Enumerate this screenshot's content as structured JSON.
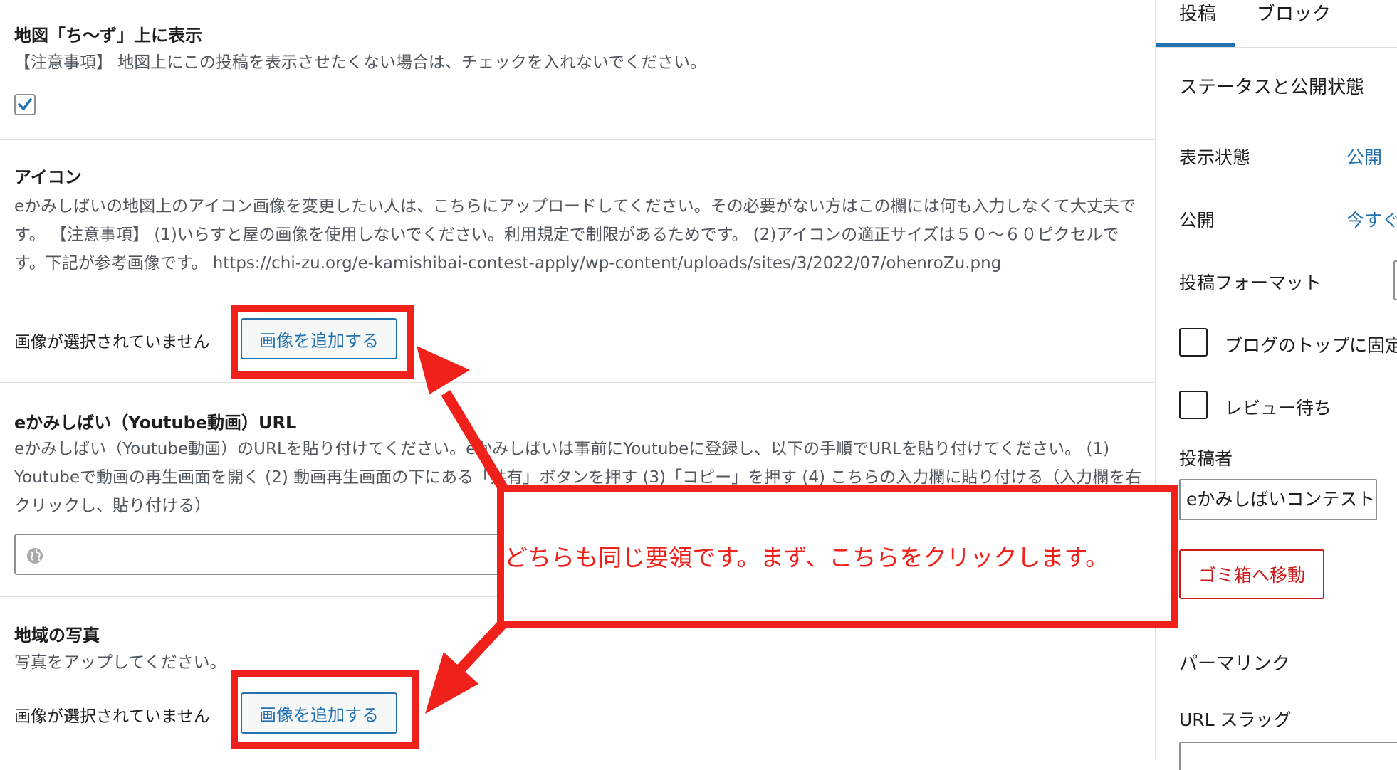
{
  "main": {
    "map_section": {
      "title": "地図「ち〜ず」上に表示",
      "description": "【注意事項】 地図上にこの投稿を表示させたくない場合は、チェックを入れないでください。",
      "checked": true
    },
    "icon_section": {
      "title": "アイコン",
      "description": "eかみしばいの地図上のアイコン画像を変更したい人は、こちらにアップロードしてください。その必要がない方はこの欄には何も入力しなくて大丈夫です。 【注意事項】 (1)いらすと屋の画像を使用しないでください。利用規定で制限があるためです。 (2)アイコンの適正サイズは５０〜６０ピクセルです。下記が参考画像です。 https://chi-zu.org/e-kamishibai-contest-apply/wp-content/uploads/sites/3/2022/07/ohenroZu.png",
      "no_image_text": "画像が選択されていません",
      "add_button_label": "画像を追加する"
    },
    "youtube_section": {
      "title": "eかみしばい（Youtube動画）URL",
      "description": "eかみしばい（Youtube動画）のURLを貼り付けてください。eかみしばいは事前にYoutubeに登録し、以下の手順でURLを貼り付けてください。 (1) Youtubeで動画の再生画面を開く (2) 動画再生画面の下にある「共有」ボタンを押す (3)「コピー」を押す (4) こちらの入力欄に貼り付ける（入力欄を右クリックし、貼り付ける）",
      "url_value": ""
    },
    "photo_section": {
      "title": "地域の写真",
      "description": "写真をアップしてください。",
      "no_image_text": "画像が選択されていません",
      "add_button_label": "画像を追加する"
    }
  },
  "sidebar": {
    "tabs": [
      "投稿",
      "ブロック"
    ],
    "active_tab": "投稿",
    "status_heading": "ステータスと公開状態",
    "visibility_label": "表示状態",
    "visibility_value": "公開",
    "publish_label": "公開",
    "publish_value": "今すぐ",
    "format_label": "投稿フォーマット",
    "sticky_label": "ブログのトップに固定",
    "pending_label": "レビュー待ち",
    "author_label": "投稿者",
    "author_value": "eかみしばいコンテスト",
    "trash_label": "ゴミ箱へ移動",
    "permalink_heading": "パーマリンク",
    "url_slug_label": "URL スラッグ"
  },
  "annotation": {
    "callout_text": "どちらも同じ要領です。まず、こちらをクリックします。",
    "color": "#f0201a"
  },
  "colors": {
    "accent": "#2271b1",
    "danger": "#cc1818",
    "annotation": "#f0201a"
  }
}
